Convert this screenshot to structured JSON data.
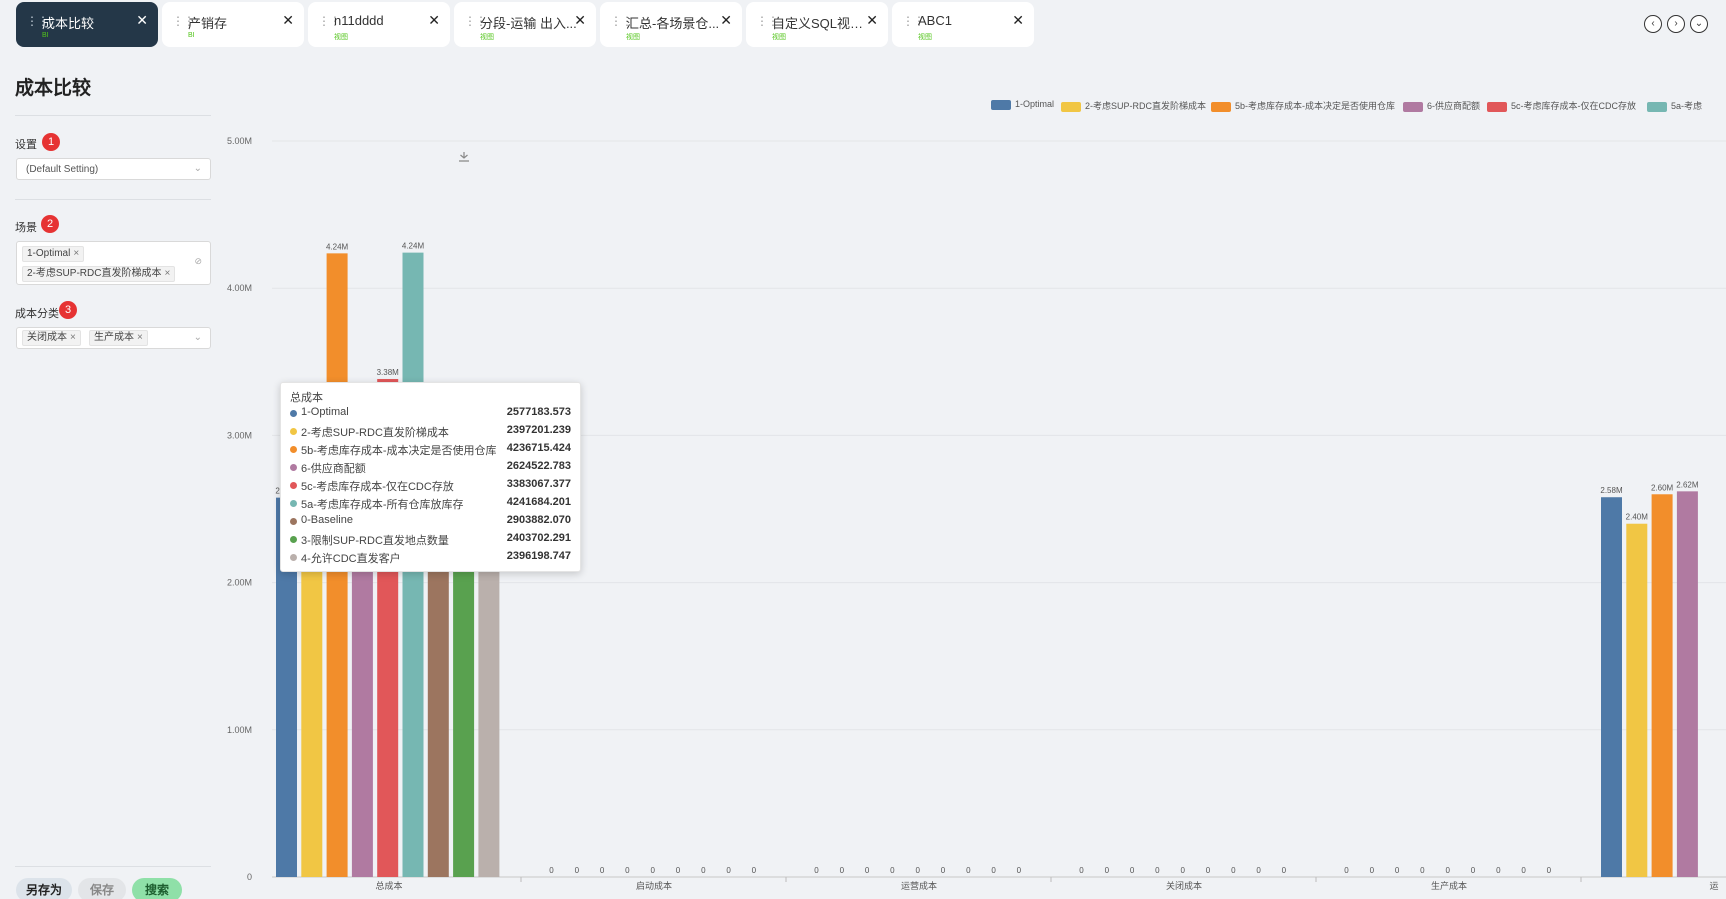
{
  "tabs": [
    {
      "title": "成本比较",
      "subtitle": "BI",
      "active": true
    },
    {
      "title": "产销存",
      "subtitle": "BI"
    },
    {
      "title": "n11dddd",
      "subtitle": "视图"
    },
    {
      "title": "分段-运输 出入...",
      "subtitle": "视图"
    },
    {
      "title": "汇总-各场景仓...",
      "subtitle": "视图"
    },
    {
      "title": "自定义SQL视图...",
      "subtitle": "视图"
    },
    {
      "title": "ABC1",
      "subtitle": "视图"
    }
  ],
  "tab_nav": {
    "prev": "‹",
    "next": "›",
    "more": "⌄"
  },
  "page": {
    "title": "成本比较"
  },
  "filters": {
    "settings": {
      "label": "设置",
      "badge": "1",
      "value": "(Default Setting)"
    },
    "scenario": {
      "label": "场景",
      "badge": "2",
      "chips": [
        "1-Optimal",
        "2-考虑SUP-RDC直发阶梯成本"
      ]
    },
    "category": {
      "label": "成本分类",
      "badge": "3",
      "chips": [
        "关闭成本",
        "生产成本"
      ]
    }
  },
  "actions": {
    "save_as": "另存为",
    "save": "保存",
    "search": "搜索"
  },
  "chart_data": {
    "type": "bar",
    "categories": [
      "总成本",
      "启动成本",
      "运营成本",
      "关闭成本",
      "生产成本",
      "运"
    ],
    "ylim": [
      0,
      5000000
    ],
    "yticks": [
      "0",
      "1.00M",
      "2.00M",
      "3.00M",
      "4.00M",
      "5.00M"
    ],
    "grid": true,
    "legend_position": "top-right",
    "series": [
      {
        "name": "1-Optimal",
        "color": "#4e79a7",
        "values": [
          2577183.573,
          0,
          0,
          0,
          0,
          2580000
        ],
        "labels": [
          "2.58M",
          "0",
          "0",
          "0",
          "0",
          "2.58M"
        ]
      },
      {
        "name": "2-考虑SUP-RDC直发阶梯成本",
        "color": "#f1c644",
        "values": [
          2397201.239,
          0,
          0,
          0,
          0,
          2400000
        ],
        "labels": [
          "2.40M",
          "0",
          "0",
          "0",
          "0",
          "2.40M"
        ]
      },
      {
        "name": "5b-考虑库存成本-成本决定是否使用仓库",
        "color": "#f28e2b",
        "values": [
          4236715.424,
          0,
          0,
          0,
          0,
          2600000
        ],
        "labels": [
          "4.24M",
          "0",
          "0",
          "0",
          "0",
          "2.60M"
        ]
      },
      {
        "name": "6-供应商配额",
        "color": "#b07aa1",
        "values": [
          2624522.783,
          0,
          0,
          0,
          0,
          2620000
        ],
        "labels": [
          "2.62M",
          "0",
          "0",
          "0",
          "0",
          "2.62M"
        ]
      },
      {
        "name": "5c-考虑库存成本-仅在CDC存放",
        "color": "#e15759",
        "values": [
          3383067.377,
          0,
          0,
          0,
          0
        ],
        "labels": [
          "3.38M",
          "0",
          "0",
          "0",
          "0"
        ]
      },
      {
        "name": "5a-考虑库存成本-所有仓库放库存",
        "color": "#76b7b2",
        "values": [
          4241684.201,
          0,
          0,
          0,
          0
        ],
        "labels": [
          "4.24M",
          "0",
          "0",
          "0",
          "0"
        ]
      },
      {
        "name": "0-Baseline",
        "color": "#9c755f",
        "values": [
          2903882.07,
          0,
          0,
          0,
          0
        ],
        "labels": [
          "2.90M",
          "0",
          "0",
          "0",
          "0"
        ]
      },
      {
        "name": "3-限制SUP-RDC直发地点数量",
        "color": "#59a14f",
        "values": [
          2403702.291,
          0,
          0,
          0,
          0
        ],
        "labels": [
          "2.40M",
          "0",
          "0",
          "0",
          "0"
        ]
      },
      {
        "name": "4-允许CDC直发客户",
        "color": "#bab0ac",
        "values": [
          2396198.747,
          0,
          0,
          0,
          0
        ],
        "labels": [
          "2.40M",
          "0",
          "0",
          "0",
          "0"
        ]
      }
    ],
    "legend": [
      {
        "name": "1-Optimal",
        "color": "#4e79a7"
      },
      {
        "name": "2-考虑SUP-RDC直发阶梯成本",
        "color": "#f1c644"
      },
      {
        "name": "5b-考虑库存成本-成本决定是否使用仓库",
        "color": "#f28e2b"
      },
      {
        "name": "6-供应商配额",
        "color": "#b07aa1"
      },
      {
        "name": "5c-考虑库存成本-仅在CDC存放",
        "color": "#e15759"
      },
      {
        "name": "5a-考虑",
        "color": "#76b7b2"
      }
    ],
    "tooltip": {
      "title": "总成本",
      "rows": [
        {
          "name": "1-Optimal",
          "value": "2577183.573",
          "color": "#4e79a7"
        },
        {
          "name": "2-考虑SUP-RDC直发阶梯成本",
          "value": "2397201.239",
          "color": "#f1c644"
        },
        {
          "name": "5b-考虑库存成本-成本决定是否使用仓库",
          "value": "4236715.424",
          "color": "#f28e2b"
        },
        {
          "name": "6-供应商配额",
          "value": "2624522.783",
          "color": "#b07aa1"
        },
        {
          "name": "5c-考虑库存成本-仅在CDC存放",
          "value": "3383067.377",
          "color": "#e15759"
        },
        {
          "name": "5a-考虑库存成本-所有仓库放库存",
          "value": "4241684.201",
          "color": "#76b7b2"
        },
        {
          "name": "0-Baseline",
          "value": "2903882.070",
          "color": "#9c755f"
        },
        {
          "name": "3-限制SUP-RDC直发地点数量",
          "value": "2403702.291",
          "color": "#59a14f"
        },
        {
          "name": "4-允许CDC直发客户",
          "value": "2396198.747",
          "color": "#bab0ac"
        }
      ]
    }
  }
}
